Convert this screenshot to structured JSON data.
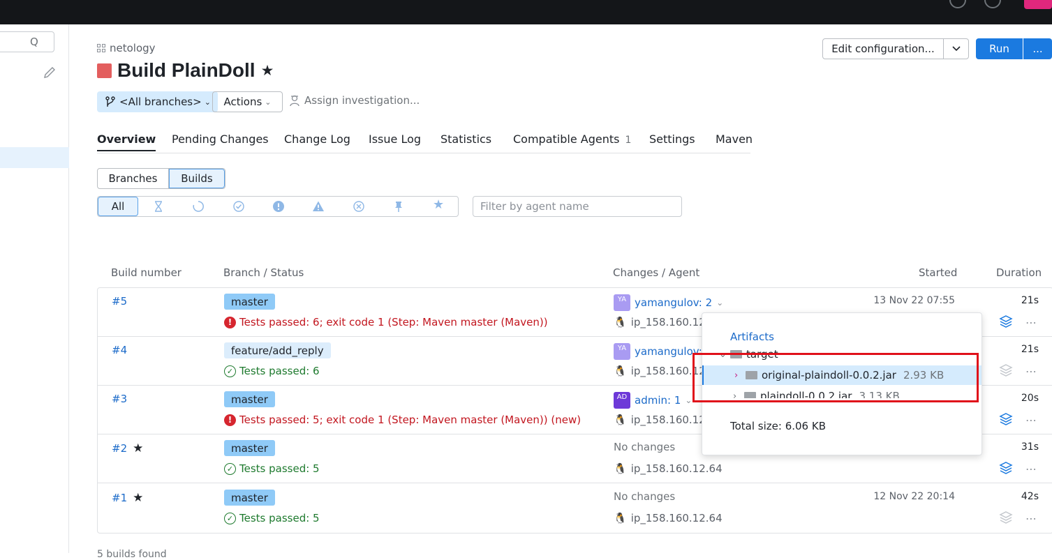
{
  "sidebar": {
    "search_placeholder": "Q"
  },
  "header": {
    "breadcrumb": "netology",
    "title": "Build PlainDoll",
    "branch_selector": "<All branches>",
    "actions_label": "Actions",
    "assign_label": "Assign investigation...",
    "edit_config_label": "Edit configuration...",
    "run_label": "Run",
    "run_more_label": "..."
  },
  "tabs": [
    {
      "label": "Overview"
    },
    {
      "label": "Pending Changes"
    },
    {
      "label": "Change Log"
    },
    {
      "label": "Issue Log"
    },
    {
      "label": "Statistics"
    },
    {
      "label": "Compatible Agents",
      "count": "1"
    },
    {
      "label": "Settings"
    },
    {
      "label": "Maven"
    }
  ],
  "view_toggle": {
    "branches": "Branches",
    "builds": "Builds",
    "selected": "Builds"
  },
  "filters": {
    "all_label": "All",
    "icons": [
      "hourglass-icon",
      "running-icon",
      "success-icon",
      "error-icon",
      "warning-icon",
      "cancelled-icon",
      "pin-icon",
      "star-icon"
    ],
    "agent_placeholder": "Filter by agent name"
  },
  "table": {
    "headers": {
      "build_number": "Build number",
      "branch_status": "Branch / Status",
      "changes_agent": "Changes / Agent",
      "started": "Started",
      "duration": "Duration"
    },
    "rows": [
      {
        "number": "#5",
        "branch": "master",
        "status": "Tests passed: 6; exit code 1 (Step: Maven master (Maven))",
        "status_type": "fail",
        "avatar": "YA",
        "change": "yamangulov: 2",
        "agent": "ip_158.160.12.6",
        "started": "13 Nov 22 07:55",
        "duration": "21s"
      },
      {
        "number": "#4",
        "branch": "feature/add_reply",
        "status": "Tests passed: 6",
        "status_type": "ok",
        "avatar": "YA",
        "change": "yamangulov:",
        "agent": "ip_158.160.12.6",
        "started": "",
        "duration": "21s"
      },
      {
        "number": "#3",
        "branch": "master",
        "status": "Tests passed: 5; exit code 1 (Step: Maven master (Maven)) (new)",
        "status_type": "fail",
        "avatar": "AD",
        "change": "admin: 1",
        "agent": "ip_158.160.12.6",
        "started": "",
        "duration": "20s"
      },
      {
        "number": "#2",
        "branch": "master",
        "status": "Tests passed: 5",
        "status_type": "ok",
        "change": "No changes",
        "agent": "ip_158.160.12.64",
        "started": "",
        "duration": "31s",
        "pinned": true
      },
      {
        "number": "#1",
        "branch": "master",
        "status": "Tests passed: 5",
        "status_type": "ok",
        "change": "No changes",
        "agent": "ip_158.160.12.64",
        "started": "12 Nov 22 20:14",
        "duration": "42s",
        "pinned": true
      }
    ]
  },
  "artifacts_popup": {
    "title": "Artifacts",
    "folder": "target",
    "files": [
      {
        "name": "original-plaindoll-0.0.2.jar",
        "size": "2.93 KB"
      },
      {
        "name": "plaindoll-0.0.2.jar",
        "size": "3.13 KB"
      }
    ],
    "total": "Total size: 6.06 KB"
  },
  "footer_text": "5 builds found",
  "colors": {
    "accent": "#1b7ae0",
    "fail": "#c2161f",
    "ok": "#1e7a2e",
    "highlight_box": "#e0101a"
  }
}
